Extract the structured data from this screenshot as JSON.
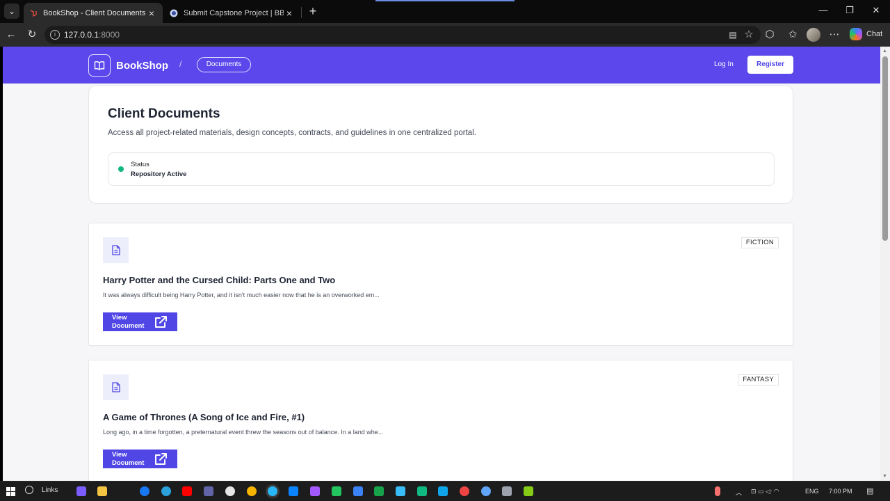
{
  "browser": {
    "tabs": [
      {
        "title": "BookShop - Client Documents",
        "active": true
      },
      {
        "title": "Submit Capstone Project | BBU IT S",
        "active": false
      }
    ],
    "url_host": "127.0.0.1",
    "url_port": ":8000",
    "copilot_label": "Chat"
  },
  "header": {
    "brand": "BookShop",
    "breadcrumb_sep": "/",
    "breadcrumb": "Documents",
    "login": "Log In",
    "register": "Register"
  },
  "intro": {
    "title": "Client Documents",
    "description": "Access all project-related materials, design concepts, contracts, and guidelines in one centralized portal.",
    "status_label": "Status",
    "status_value": "Repository Active"
  },
  "documents": [
    {
      "category": "FICTION",
      "title": "Harry Potter and the Cursed Child: Parts One and Two",
      "excerpt": "It was always difficult being Harry Potter, and it isn't much easier now that he is an overworked em...",
      "button": "View\nDocument"
    },
    {
      "category": "FANTASY",
      "title": "A Game of Thrones (A Song of Ice and Fire, #1)",
      "excerpt": "Long ago, in a time forgotten, a preternatural event threw the seasons out of balance. In a land whe...",
      "button": "View\nDocument"
    }
  ],
  "taskbar": {
    "search_label": "Links",
    "language": "ENG",
    "time": "7:00 PM"
  },
  "colors": {
    "brand": "#5b47ec",
    "button": "#4f46e5",
    "status_active": "#10b981"
  }
}
